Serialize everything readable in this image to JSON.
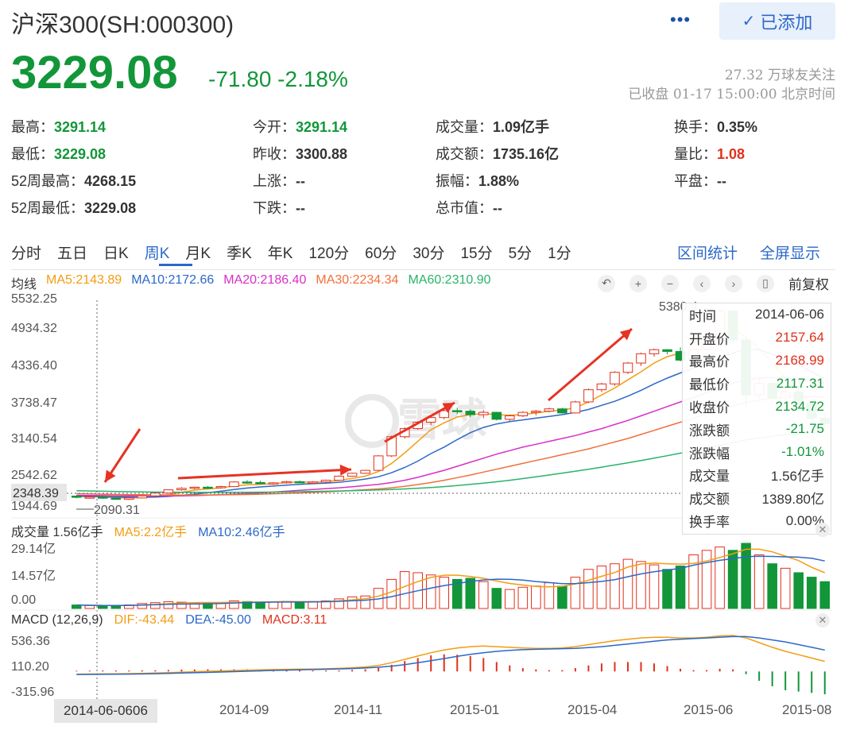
{
  "header": {
    "title": "沪深300(SH:000300)",
    "more_label": "•••",
    "added_label": "已添加",
    "price": "3229.08",
    "change": "-71.80  -2.18%",
    "followers": "27.32 万球友关注",
    "status": "已收盘 01-17 15:00:00 北京时间"
  },
  "stats": [
    {
      "label": "最高：",
      "value": "3291.14",
      "color": "green"
    },
    {
      "label": "今开：",
      "value": "3291.14",
      "color": "green"
    },
    {
      "label": "成交量：",
      "value": "1.09亿手",
      "color": ""
    },
    {
      "label": "换手：",
      "value": "0.35%",
      "color": ""
    },
    {
      "label": "最低：",
      "value": "3229.08",
      "color": "green"
    },
    {
      "label": "昨收：",
      "value": "3300.88",
      "color": ""
    },
    {
      "label": "成交额：",
      "value": "1735.16亿",
      "color": ""
    },
    {
      "label": "量比：",
      "value": "1.08",
      "color": "red"
    },
    {
      "label": "52周最高：",
      "value": "4268.15",
      "color": ""
    },
    {
      "label": "上涨：",
      "value": "--",
      "color": ""
    },
    {
      "label": "振幅：",
      "value": "1.88%",
      "color": ""
    },
    {
      "label": "平盘：",
      "value": "--",
      "color": ""
    },
    {
      "label": "52周最低：",
      "value": "3229.08",
      "color": ""
    },
    {
      "label": "下跌：",
      "value": "--",
      "color": ""
    },
    {
      "label": "总市值：",
      "value": "--",
      "color": ""
    }
  ],
  "periods": [
    "分时",
    "五日",
    "日K",
    "周K",
    "月K",
    "季K",
    "年K",
    "120分",
    "60分",
    "30分",
    "15分",
    "5分",
    "1分"
  ],
  "active_period": "周K",
  "links": {
    "range_stats": "区间统计",
    "fullscreen": "全屏显示"
  },
  "ma_legend": [
    {
      "label": "均线",
      "color": "#333333"
    },
    {
      "label": "MA5:2143.89",
      "color": "#f39c12"
    },
    {
      "label": "MA10:2172.66",
      "color": "#2c68c8"
    },
    {
      "label": "MA20:2186.40",
      "color": "#d82fc8"
    },
    {
      "label": "MA30:2234.34",
      "color": "#f0703c"
    },
    {
      "label": "MA60:2310.90",
      "color": "#2ab36a"
    }
  ],
  "tools": {
    "undo": "↶",
    "zoom_in": "+",
    "zoom_out": "−",
    "prev": "‹",
    "next": "›",
    "candle": "▯",
    "adjust": "前复权"
  },
  "price_axis": [
    "5532.25",
    "4934.32",
    "4336.40",
    "3738.47",
    "3140.54",
    "2542.62",
    "1944.69"
  ],
  "crosshair_price": "2348.39",
  "low_label": "2090.31",
  "high_label": "5380.4",
  "watermark": "雪球",
  "tooltip": [
    {
      "k": "时间",
      "v": "2014-06-06",
      "color": "#333333"
    },
    {
      "k": "开盘价",
      "v": "2157.64",
      "color": "#e0311c"
    },
    {
      "k": "最高价",
      "v": "2168.99",
      "color": "#e0311c"
    },
    {
      "k": "最低价",
      "v": "2117.31",
      "color": "#129639"
    },
    {
      "k": "收盘价",
      "v": "2134.72",
      "color": "#129639"
    },
    {
      "k": "涨跌额",
      "v": "-21.75",
      "color": "#129639"
    },
    {
      "k": "涨跌幅",
      "v": "-1.01%",
      "color": "#129639"
    },
    {
      "k": "成交量",
      "v": "1.56亿手",
      "color": "#333333"
    },
    {
      "k": "成交额",
      "v": "1389.80亿",
      "color": "#333333"
    },
    {
      "k": "换手率",
      "v": "0.00%",
      "color": "#333333"
    }
  ],
  "volume_legend": [
    {
      "label": "成交量 1.56亿手",
      "color": "#333333"
    },
    {
      "label": "MA5:2.2亿手",
      "color": "#f39c12"
    },
    {
      "label": "MA10:2.46亿手",
      "color": "#2c68c8"
    }
  ],
  "volume_axis": [
    "29.14亿",
    "14.57亿",
    "0.00"
  ],
  "macd_legend": [
    {
      "label": "MACD (12,26,9)",
      "color": "#333333"
    },
    {
      "label": "DIF:-43.44",
      "color": "#f39c12"
    },
    {
      "label": "DEA:-45.00",
      "color": "#2c68c8"
    },
    {
      "label": "MACD:3.11",
      "color": "#e0311c"
    }
  ],
  "macd_axis": [
    "536.36",
    "110.20",
    "-315.96"
  ],
  "x_labels": [
    "2014-09",
    "2014-11",
    "2015-01",
    "2015-04",
    "2015-06",
    "2015-08"
  ],
  "selected_date": "2014-06-06",
  "selected_date_suffix": "06",
  "chart_data": {
    "type": "candlestick",
    "x": [
      "2014-06",
      "2014-06",
      "2014-06",
      "2014-06",
      "2014-07",
      "2014-07",
      "2014-07",
      "2014-07",
      "2014-08",
      "2014-08",
      "2014-08",
      "2014-08",
      "2014-09",
      "2014-09",
      "2014-09",
      "2014-09",
      "2014-10",
      "2014-10",
      "2014-10",
      "2014-10",
      "2014-10",
      "2014-11",
      "2014-11",
      "2014-11",
      "2014-12",
      "2014-12",
      "2014-12",
      "2014-12",
      "2015-01",
      "2015-01",
      "2015-01",
      "2015-01",
      "2015-02",
      "2015-02",
      "2015-02",
      "2015-03",
      "2015-03",
      "2015-03",
      "2015-03",
      "2015-04",
      "2015-04",
      "2015-04",
      "2015-04",
      "2015-05",
      "2015-05",
      "2015-05",
      "2015-05",
      "2015-06",
      "2015-06",
      "2015-06",
      "2015-06",
      "2015-07",
      "2015-07",
      "2015-07",
      "2015-07",
      "2015-08",
      "2015-08",
      "2015-08"
    ],
    "candles": [
      [
        2157,
        2169,
        2117,
        2135
      ],
      [
        2135,
        2160,
        2120,
        2140
      ],
      [
        2140,
        2150,
        2110,
        2120
      ],
      [
        2120,
        2140,
        2095,
        2100
      ],
      [
        2100,
        2130,
        2090,
        2125
      ],
      [
        2125,
        2165,
        2115,
        2160
      ],
      [
        2160,
        2215,
        2150,
        2210
      ],
      [
        2210,
        2270,
        2200,
        2265
      ],
      [
        2265,
        2310,
        2250,
        2290
      ],
      [
        2290,
        2320,
        2270,
        2310
      ],
      [
        2310,
        2330,
        2280,
        2300
      ],
      [
        2300,
        2335,
        2285,
        2320
      ],
      [
        2320,
        2410,
        2310,
        2400
      ],
      [
        2400,
        2430,
        2370,
        2390
      ],
      [
        2390,
        2420,
        2360,
        2370
      ],
      [
        2370,
        2400,
        2350,
        2385
      ],
      [
        2385,
        2420,
        2370,
        2405
      ],
      [
        2405,
        2425,
        2380,
        2390
      ],
      [
        2390,
        2415,
        2370,
        2400
      ],
      [
        2400,
        2440,
        2390,
        2430
      ],
      [
        2430,
        2510,
        2420,
        2500
      ],
      [
        2500,
        2560,
        2490,
        2550
      ],
      [
        2550,
        2610,
        2540,
        2600
      ],
      [
        2600,
        2860,
        2590,
        2850
      ],
      [
        2850,
        3200,
        2830,
        3180
      ],
      [
        3180,
        3340,
        3150,
        3320
      ],
      [
        3320,
        3450,
        3300,
        3430
      ],
      [
        3430,
        3530,
        3380,
        3510
      ],
      [
        3510,
        3650,
        3480,
        3630
      ],
      [
        3630,
        3680,
        3570,
        3620
      ],
      [
        3620,
        3650,
        3520,
        3560
      ],
      [
        3560,
        3640,
        3500,
        3600
      ],
      [
        3600,
        3610,
        3460,
        3480
      ],
      [
        3480,
        3560,
        3450,
        3540
      ],
      [
        3540,
        3620,
        3520,
        3600
      ],
      [
        3600,
        3640,
        3550,
        3620
      ],
      [
        3620,
        3680,
        3600,
        3660
      ],
      [
        3660,
        3680,
        3580,
        3590
      ],
      [
        3590,
        3800,
        3580,
        3780
      ],
      [
        3780,
        4010,
        3760,
        3990
      ],
      [
        3990,
        4110,
        3950,
        4090
      ],
      [
        4090,
        4310,
        4060,
        4290
      ],
      [
        4290,
        4470,
        4260,
        4450
      ],
      [
        4450,
        4630,
        4400,
        4610
      ],
      [
        4610,
        4700,
        4560,
        4680
      ],
      [
        4680,
        4690,
        4600,
        4650
      ],
      [
        4650,
        4720,
        4480,
        4500
      ],
      [
        4500,
        4700,
        4480,
        4690
      ],
      [
        4690,
        4950,
        4670,
        4930
      ],
      [
        4930,
        5380,
        4900,
        5350
      ],
      [
        5350,
        5360,
        4800,
        4850
      ],
      [
        4850,
        4900,
        3700,
        3900
      ],
      [
        3900,
        4200,
        3850,
        4100
      ],
      [
        4100,
        4150,
        3800,
        3850
      ],
      [
        3850,
        4000,
        3780,
        3950
      ],
      [
        3950,
        4050,
        3700,
        3750
      ],
      [
        3750,
        3800,
        3400,
        3500
      ],
      [
        3500,
        3600,
        3300,
        3400
      ]
    ],
    "volume": [
      1.56,
      1.3,
      1.2,
      1.3,
      1.6,
      2.2,
      2.6,
      3.0,
      2.8,
      2.5,
      2.4,
      2.6,
      3.4,
      3.1,
      2.9,
      3.0,
      3.2,
      3.0,
      3.1,
      3.4,
      4.3,
      5.2,
      5.6,
      9.0,
      13.0,
      16.5,
      16.0,
      15.0,
      14.0,
      13.0,
      13.5,
      12.0,
      9.0,
      8.5,
      9.5,
      10.0,
      11.5,
      10.0,
      14.0,
      17.5,
      19.0,
      20.0,
      22.0,
      21.0,
      19.5,
      17.5,
      19.0,
      24.0,
      26.0,
      27.5,
      26.0,
      29.14,
      24.0,
      20.0,
      18.0,
      16.0,
      14.0,
      12.0
    ],
    "ma": {
      "MA5": [
        2150,
        2148,
        2140,
        2130,
        2125,
        2130,
        2150,
        2180,
        2220,
        2260,
        2280,
        2300,
        2330,
        2350,
        2360,
        2370,
        2390,
        2400,
        2395,
        2405,
        2430,
        2460,
        2500,
        2580,
        2720,
        2900,
        3100,
        3300,
        3420,
        3520,
        3560,
        3580,
        3560,
        3550,
        3560,
        3590,
        3620,
        3640,
        3680,
        3780,
        3900,
        4020,
        4160,
        4300,
        4450,
        4560,
        4620,
        4640,
        4720,
        4900,
        5050,
        4900,
        4700,
        4450,
        4200,
        3950,
        3750,
        3650
      ],
      "MA10": [
        2155,
        2152,
        2148,
        2142,
        2138,
        2136,
        2140,
        2150,
        2170,
        2190,
        2215,
        2240,
        2270,
        2295,
        2315,
        2330,
        2345,
        2360,
        2370,
        2380,
        2395,
        2420,
        2450,
        2490,
        2560,
        2650,
        2760,
        2890,
        3000,
        3130,
        3250,
        3340,
        3400,
        3440,
        3470,
        3500,
        3530,
        3560,
        3600,
        3650,
        3720,
        3790,
        3880,
        3980,
        4090,
        4190,
        4280,
        4360,
        4430,
        4520,
        4620,
        4700,
        4680,
        4600,
        4520,
        4420,
        4300,
        4180
      ],
      "MA20": [
        2170,
        2168,
        2165,
        2162,
        2160,
        2158,
        2157,
        2158,
        2160,
        2165,
        2172,
        2180,
        2190,
        2200,
        2212,
        2225,
        2240,
        2255,
        2270,
        2285,
        2300,
        2318,
        2338,
        2360,
        2390,
        2430,
        2480,
        2540,
        2600,
        2670,
        2740,
        2810,
        2880,
        2940,
        3000,
        3050,
        3100,
        3150,
        3200,
        3260,
        3320,
        3390,
        3460,
        3540,
        3620,
        3700,
        3780,
        3860,
        3940,
        4020,
        4100,
        4160,
        4190,
        4200,
        4190,
        4170,
        4140,
        4100
      ],
      "MA30": [
        2200,
        2195,
        2190,
        2185,
        2182,
        2180,
        2178,
        2176,
        2175,
        2175,
        2176,
        2178,
        2181,
        2185,
        2190,
        2196,
        2203,
        2211,
        2220,
        2230,
        2241,
        2253,
        2266,
        2280,
        2300,
        2325,
        2355,
        2390,
        2430,
        2475,
        2520,
        2570,
        2620,
        2670,
        2720,
        2770,
        2820,
        2870,
        2920,
        2970,
        3030,
        3090,
        3150,
        3220,
        3290,
        3360,
        3430,
        3500,
        3570,
        3640,
        3710,
        3770,
        3810,
        3840,
        3860,
        3870,
        3870,
        3860
      ],
      "MA60": [
        2250,
        2245,
        2240,
        2236,
        2232,
        2229,
        2226,
        2224,
        2222,
        2221,
        2220,
        2220,
        2221,
        2222,
        2224,
        2226,
        2229,
        2232,
        2236,
        2240,
        2245,
        2250,
        2256,
        2263,
        2271,
        2280,
        2292,
        2305,
        2320,
        2338,
        2358,
        2380,
        2404,
        2430,
        2458,
        2488,
        2520,
        2552,
        2586,
        2620,
        2656,
        2692,
        2730,
        2770,
        2810,
        2852,
        2896,
        2940,
        2986,
        3032,
        3080,
        3126,
        3160,
        3190,
        3215,
        3235,
        3250,
        3262
      ]
    },
    "macd": {
      "dif": [
        -40,
        -38,
        -36,
        -34,
        -32,
        -28,
        -24,
        -18,
        -10,
        -4,
        2,
        8,
        14,
        20,
        24,
        28,
        32,
        34,
        36,
        40,
        46,
        56,
        68,
        90,
        130,
        180,
        230,
        280,
        320,
        350,
        370,
        380,
        370,
        360,
        350,
        345,
        345,
        350,
        370,
        400,
        430,
        460,
        480,
        500,
        510,
        510,
        500,
        500,
        510,
        530,
        536,
        500,
        430,
        360,
        300,
        250,
        200,
        150
      ],
      "dea": [
        -45,
        -44,
        -43,
        -41,
        -39,
        -36,
        -33,
        -29,
        -24,
        -19,
        -14,
        -8,
        -2,
        4,
        10,
        15,
        20,
        25,
        29,
        33,
        38,
        44,
        52,
        63,
        80,
        102,
        130,
        160,
        192,
        225,
        255,
        280,
        300,
        315,
        325,
        330,
        335,
        340,
        345,
        355,
        370,
        390,
        410,
        430,
        450,
        470,
        480,
        490,
        500,
        510,
        520,
        520,
        500,
        470,
        440,
        400,
        360,
        320
      ]
    },
    "ylim": [
      1944.69,
      5532.25
    ]
  }
}
